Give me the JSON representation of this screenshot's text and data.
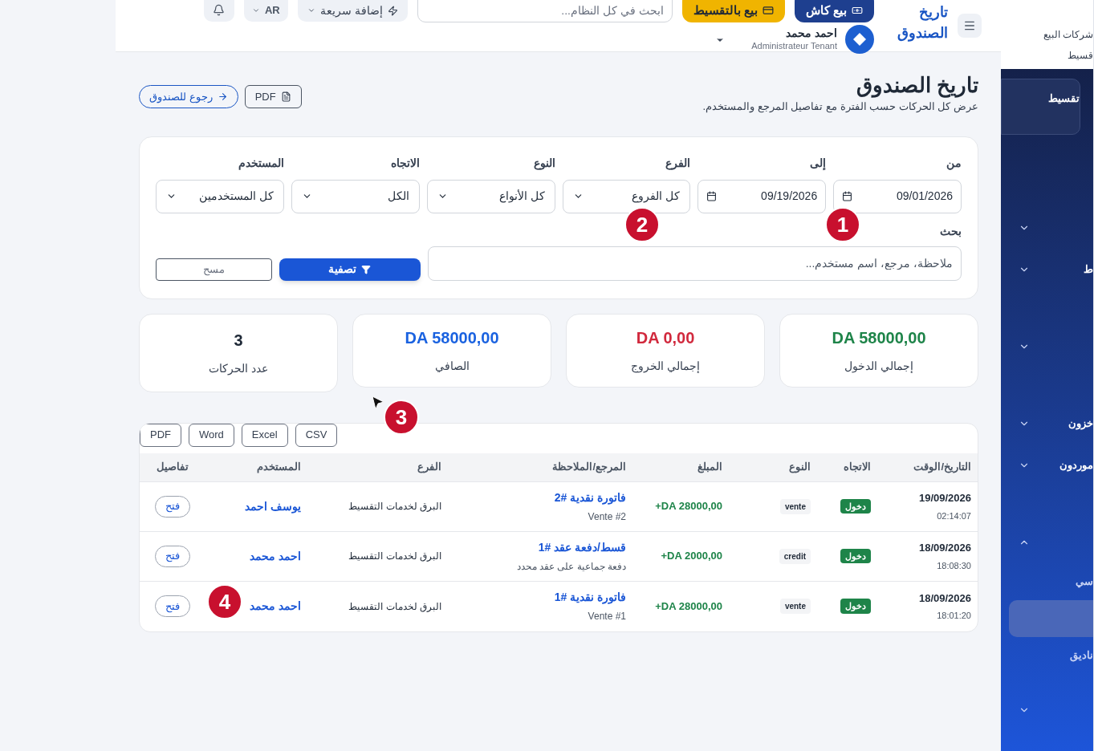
{
  "header": {
    "page_title": "تاريخ الصندوق",
    "buttons": [
      {
        "label": "بيع كاش",
        "kind": "cash"
      },
      {
        "label": "بيع بالتقسيط",
        "kind": "installment"
      }
    ],
    "search": {
      "placeholder": "ابحث في كل النظام..."
    },
    "quick_add": "إضافة سريعة",
    "language": "AR",
    "user": {
      "name": "احمد محمد",
      "role": "Administrateur Tenant"
    }
  },
  "page": {
    "title": "تاريخ الصندوق",
    "subtitle": "عرض كل الحركات حسب الفترة مع تفاصيل المرجع والمستخدم.",
    "actions": [
      {
        "label": "PDF",
        "kind": "pdf"
      },
      {
        "label": "رجوع للصندوق",
        "kind": "back"
      }
    ]
  },
  "filters": {
    "fields": [
      {
        "label": "من",
        "kind": "date",
        "value": "09/01/2026"
      },
      {
        "label": "إلى",
        "kind": "date",
        "value": "09/19/2026"
      },
      {
        "label": "الفرع",
        "kind": "select",
        "value": "كل الفروع"
      },
      {
        "label": "النوع",
        "kind": "select",
        "value": "كل الأنواع"
      },
      {
        "label": "الاتجاه",
        "kind": "select",
        "value": "الكل"
      },
      {
        "label": "المستخدم",
        "kind": "select",
        "value": "كل المستخدمين"
      }
    ],
    "search_label": "بحث",
    "search_placeholder": "ملاحظة، مرجع، اسم مستخدم...",
    "filter_button": "تصفية",
    "clear_button": "مسح"
  },
  "stats": [
    {
      "value": "DA 58000,00",
      "label": "إجمالي الدخول",
      "color": "#1e8449"
    },
    {
      "value": "DA 0,00",
      "label": "إجمالي الخروج",
      "color": "#d1293d"
    },
    {
      "value": "DA 58000,00",
      "label": "الصافي",
      "color": "#1a62e0"
    },
    {
      "value": "3",
      "label": "عدد الحركات",
      "color": "#1f2937"
    }
  ],
  "table": {
    "exports": [
      "CSV",
      "Excel",
      "Word",
      "PDF"
    ],
    "columns": [
      "التاريخ/الوقت",
      "الاتجاه",
      "النوع",
      "المبلغ",
      "المرجع/الملاحظة",
      "الفرع",
      "المستخدم",
      "تفاصيل"
    ],
    "rows": [
      {
        "date": "19/09/2026",
        "time": "02:14:07",
        "direction": "دخول",
        "type": "vente",
        "amount": "+DA 28000,00",
        "reference": "فاتورة نقدية #2",
        "note": "Vente #2",
        "branch": "البرق لخدمات التقسيط",
        "user": "يوسف احمد",
        "action": "فتح"
      },
      {
        "date": "18/09/2026",
        "time": "18:08:30",
        "direction": "دخول",
        "type": "credit",
        "amount": "+DA 2000,00",
        "reference": "قسط/دفعة عقد #1",
        "note": "دفعة جماعية على عقد محدد",
        "branch": "البرق لخدمات التقسيط",
        "user": "احمد محمد",
        "action": "فتح"
      },
      {
        "date": "18/09/2026",
        "time": "18:01:20",
        "direction": "دخول",
        "type": "vente",
        "amount": "+DA 28000,00",
        "reference": "فاتورة نقدية #1",
        "note": "Vente #1",
        "branch": "البرق لخدمات التقسيط",
        "user": "احمد محمد",
        "action": "فتح"
      }
    ]
  },
  "sidebar": {
    "top_items": [
      "شركات البيع",
      "قسيط"
    ],
    "card": "تقسيط",
    "items": [
      {
        "expanded": false
      },
      {
        "label": "ط",
        "expanded": false
      },
      {
        "expanded": false
      },
      {
        "label": "خزون",
        "expanded": false
      },
      {
        "label": "موردون",
        "expanded": false
      },
      {
        "expanded": true
      }
    ],
    "sub_items": [
      {
        "label": "سي",
        "selected": false
      },
      {
        "selected": true
      },
      {
        "label": "ناديق",
        "selected": false
      }
    ],
    "last_item_expanded": false
  },
  "markers": [
    "1",
    "2",
    "3",
    "4"
  ]
}
